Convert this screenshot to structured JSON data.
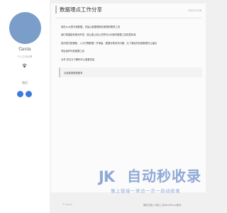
{
  "sidebar": {
    "name": "Gavin",
    "description": "个人工作分享",
    "nav_home": "首页"
  },
  "article": {
    "title": "数据埋点工作分享",
    "date": "2019-12-28",
    "paragraphs": [
      "我在xx大型平面数据，完善从数据埋报至管理到需求工具",
      "我们希望能有便利开发、能让能让到公式帮可以利用时数据工具底层标准",
      "如何把已配置取、入口只需数据一开事最，数据对着到写问题，为了满足的化数数据可让建议",
      "项目最好列到重要工具",
      "为本 完位为下解构可以重要说话"
    ],
    "quote": "功能数据埋报要求"
  },
  "watermark": {
    "mark": "JK",
    "title": "自动秒收录",
    "subtitle": "做上链接一来访一次一自动收录"
  },
  "footer": {
    "left": "© Gavin",
    "right": "微信扫描 | 网站 | 由WordPress驱动"
  },
  "colors": {
    "avatar": "#7a9ec9",
    "social": "#3d7bd9",
    "watermark": "#8fa9d6"
  }
}
